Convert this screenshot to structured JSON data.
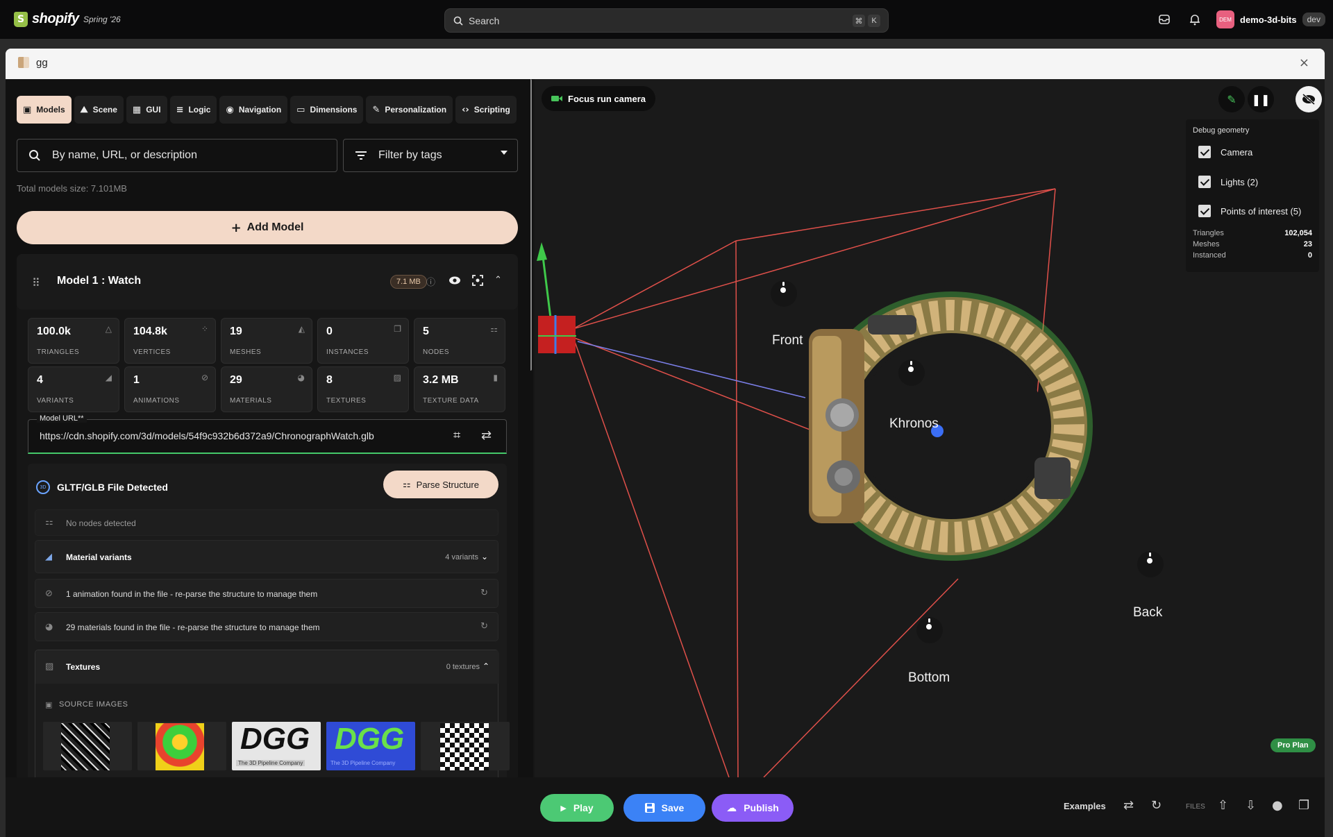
{
  "topbar": {
    "brand": "shopify",
    "edition": "Spring '26",
    "search_placeholder": "Search",
    "shortcut_keys": [
      "⌘",
      "K"
    ],
    "store_initials": "DEM",
    "store_name": "demo-3d-bits",
    "store_badge": "dev"
  },
  "window": {
    "title": "gg",
    "close_glyph": "×"
  },
  "tabs": [
    {
      "label": "Models",
      "icon": "models-icon",
      "glyph": "▣",
      "active": true
    },
    {
      "label": "Scene",
      "icon": "scene-icon",
      "glyph": "⛰",
      "active": false
    },
    {
      "label": "GUI",
      "icon": "gui-icon",
      "glyph": "▦",
      "active": false
    },
    {
      "label": "Logic",
      "icon": "logic-icon",
      "glyph": "≡",
      "active": false
    },
    {
      "label": "Navigation",
      "icon": "navigation-icon",
      "glyph": "◉",
      "active": false
    },
    {
      "label": "Dimensions",
      "icon": "dimensions-icon",
      "glyph": "▭",
      "active": false
    },
    {
      "label": "Personalization",
      "icon": "personalization-icon",
      "glyph": "✎",
      "active": false
    },
    {
      "label": "Scripting",
      "icon": "scripting-icon",
      "glyph": "‹›",
      "active": false
    }
  ],
  "filters": {
    "search_placeholder": "By name, URL, or description",
    "tags_placeholder": "Filter by tags"
  },
  "total_size": "Total models size: 7.101MB",
  "add_model_label": "Add Model",
  "model": {
    "title": "Model 1 : Watch",
    "size_badge": "7.1 MB",
    "stats": [
      {
        "value": "100.0k",
        "label": "TRIANGLES",
        "icon": "triangle-icon",
        "glyph": "△"
      },
      {
        "value": "104.8k",
        "label": "VERTICES",
        "icon": "vertices-icon",
        "glyph": "⁘"
      },
      {
        "value": "19",
        "label": "MESHES",
        "icon": "meshes-icon",
        "glyph": "◭"
      },
      {
        "value": "0",
        "label": "INSTANCES",
        "icon": "instances-icon",
        "glyph": "❐"
      },
      {
        "value": "5",
        "label": "NODES",
        "icon": "nodes-icon",
        "glyph": "⚏"
      },
      {
        "value": "4",
        "label": "VARIANTS",
        "icon": "variants-icon",
        "glyph": "◢"
      },
      {
        "value": "1",
        "label": "ANIMATIONS",
        "icon": "animations-icon",
        "glyph": "⊘"
      },
      {
        "value": "29",
        "label": "MATERIALS",
        "icon": "materials-icon",
        "glyph": "◕"
      },
      {
        "value": "8",
        "label": "TEXTURES",
        "icon": "textures-icon",
        "glyph": "▨"
      },
      {
        "value": "3.2 MB",
        "label": "TEXTURE DATA",
        "icon": "texture-data-icon",
        "glyph": "▮"
      }
    ],
    "url_label": "Model URL**",
    "url_value": "https://cdn.shopify.com/3d/models/54f9c932b6d372a9/ChronographWatch.glb"
  },
  "gltf": {
    "badge": "3D",
    "title": "GLTF/GLB File Detected",
    "parse_label": "Parse Structure",
    "no_nodes": "No nodes detected",
    "variants_label": "Material variants",
    "variants_count": "4 variants",
    "animation_note": "1 animation found in the file - re-parse the structure to manage them",
    "materials_note": "29 materials found in the file - re-parse the structure to manage them",
    "textures_label": "Textures",
    "textures_count": "0 textures",
    "source_images_label": "SOURCE IMAGES",
    "thumb_logo_text": "DGG",
    "thumb_logo_caption": "The 3D Pipeline Company"
  },
  "viewport": {
    "focus_label": "Focus run camera",
    "debug": {
      "heading": "Debug geometry",
      "checks": [
        {
          "label": "Camera",
          "checked": true
        },
        {
          "label": "Lights (2)",
          "checked": true
        },
        {
          "label": "Points of interest (5)",
          "checked": true
        }
      ],
      "stats": [
        {
          "label": "Triangles",
          "value": "102,054"
        },
        {
          "label": "Meshes",
          "value": "23"
        },
        {
          "label": "Instanced",
          "value": "0"
        }
      ]
    },
    "poi_labels": {
      "front": "Front",
      "khronos": "Khronos",
      "back": "Back",
      "bottom": "Bottom"
    },
    "plan_badge": "Pro Plan"
  },
  "bottombar": {
    "play_label": "Play",
    "save_label": "Save",
    "publish_label": "Publish",
    "examples_label": "Examples",
    "files_label": "FILES"
  },
  "colors": {
    "accent_peach": "#f3d9c8",
    "play_green": "#4cc974",
    "save_blue": "#3b82f6",
    "publish_purple": "#8b5cf6",
    "url_focus_green": "#45c96a",
    "camera_frustum_red": "#e0504a"
  }
}
